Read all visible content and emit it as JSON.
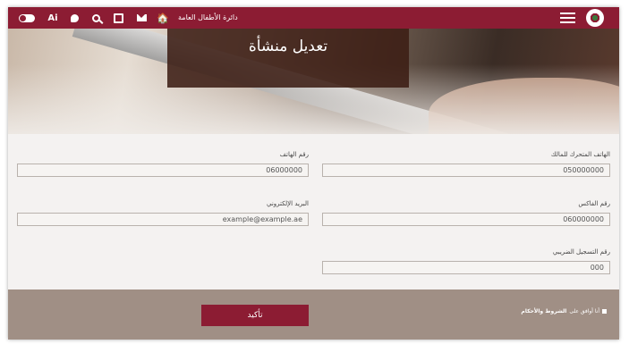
{
  "header": {
    "site_title": "دائرة الأطفال العامة",
    "ai_label": "Ai",
    "home_glyph": "🏠"
  },
  "hero": {
    "title": "تعديل منشأة"
  },
  "form": {
    "mobile_label": "الهاتف المتحرك للمالك",
    "mobile_value": "050000000",
    "phone_label": "رقم الهاتف",
    "phone_value": "06000000",
    "fax_label": "رقم الفاكس",
    "fax_value": "060000000",
    "email_label": "البريد الإلكتروني",
    "email_value": "example@example.ae",
    "tax_label": "رقم التسجيل الضريبي",
    "tax_value": "000"
  },
  "footer": {
    "confirm_label": "تأكيد",
    "terms_prefix": "أنا أوافق على",
    "terms_link": "الشروط والأحكام"
  },
  "colors": {
    "brand": "#8c1c33",
    "footer_bg": "#a08f85"
  }
}
